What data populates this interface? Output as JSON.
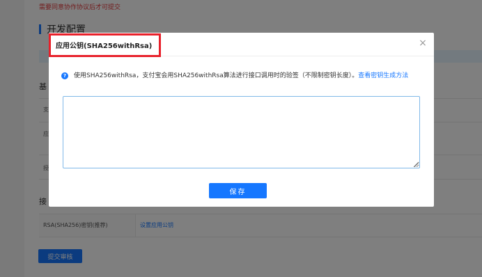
{
  "page": {
    "top_note": "需要同意协作协议后才可提交",
    "section_title": "开发配置",
    "left_labels": [
      "基",
      "接"
    ],
    "row_labels": [
      "支",
      "应",
      "授"
    ],
    "api_row": {
      "label": "RSA(SHA256)密钥(推荐)",
      "link": "设置应用公钥"
    },
    "submit_label": "提交审核"
  },
  "modal": {
    "title": "应用公钥(SHA256withRsa)",
    "close_glyph": "×",
    "tip_text": "使用SHA256withRsa，支付宝会用SHA256withRsa算法进行接口调用时的验签（不限制密钥长度）。",
    "tip_link": "查看密钥生成方法",
    "textarea_value": "",
    "save_label": "保存"
  },
  "colors": {
    "primary": "#1677ff",
    "highlight": "#e8202a",
    "warning_text": "#e4393c"
  }
}
